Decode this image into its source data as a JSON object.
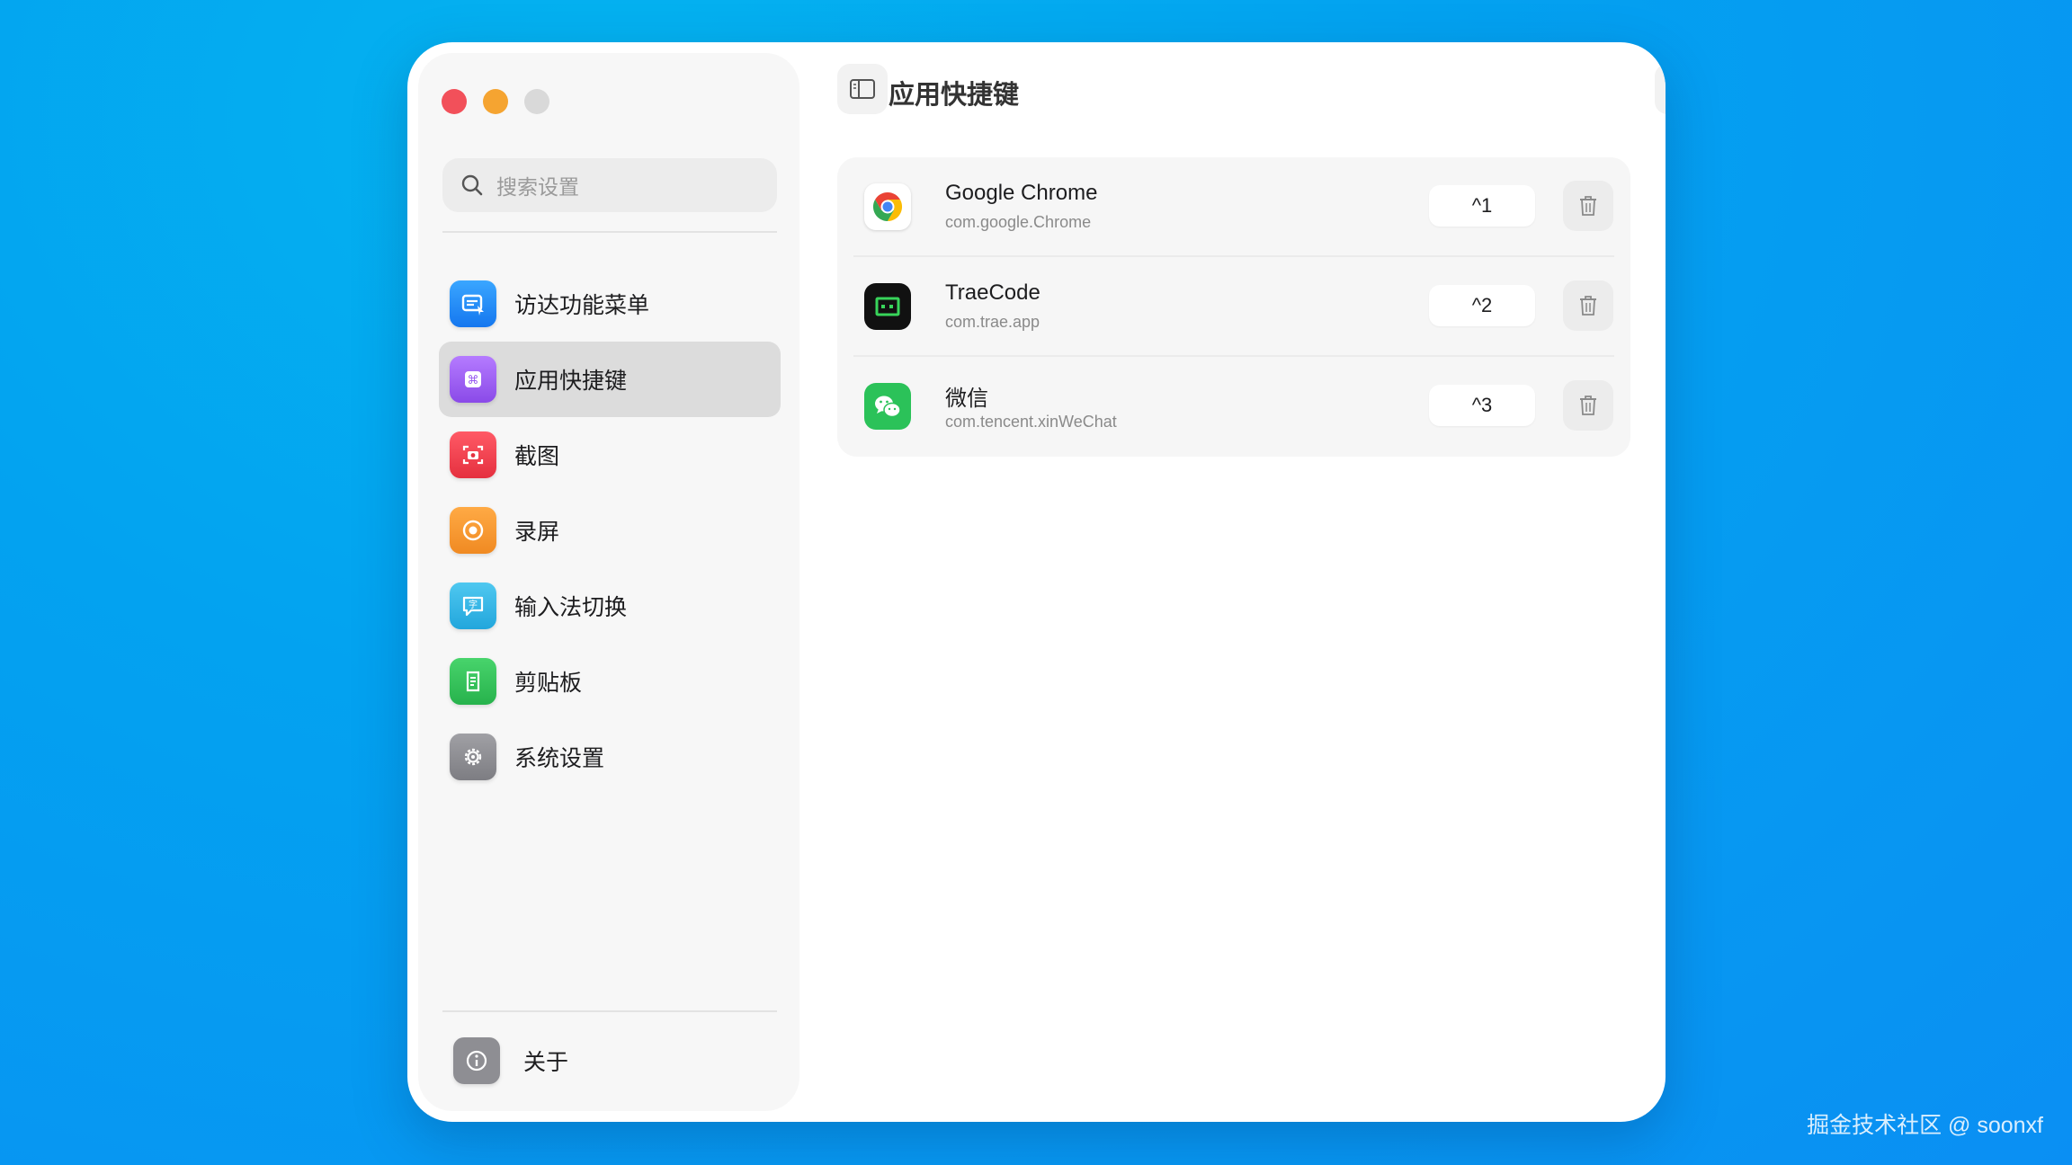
{
  "sidebar": {
    "search_placeholder": "搜索设置",
    "items": [
      {
        "label": "访达功能菜单",
        "icon": "finder-menu-icon",
        "color": "#1e8ef5"
      },
      {
        "label": "应用快捷键",
        "icon": "command-icon",
        "color": "#a25ef0"
      },
      {
        "label": "截图",
        "icon": "camera-icon",
        "color": "#f0414f"
      },
      {
        "label": "录屏",
        "icon": "record-icon",
        "color": "#f5982f"
      },
      {
        "label": "输入法切换",
        "icon": "input-method-icon",
        "color": "#35b6e6"
      },
      {
        "label": "剪贴板",
        "icon": "clipboard-icon",
        "color": "#35c459"
      },
      {
        "label": "系统设置",
        "icon": "gear-icon",
        "color": "#8e8e93"
      }
    ],
    "active_index": 1,
    "about_label": "关于"
  },
  "header": {
    "title": "应用快捷键",
    "toolbar_icons": [
      "sidebar-toggle-icon",
      "align-left-icon",
      "camera-icon",
      "drop-icon",
      "sort-arrows-icon",
      "plus-icon",
      "help-icon"
    ]
  },
  "apps": [
    {
      "name": "Google Chrome",
      "bundle": "com.google.Chrome",
      "shortcut": "^1"
    },
    {
      "name": "TraeCode",
      "bundle": "com.trae.app",
      "shortcut": "^2"
    },
    {
      "name": "微信",
      "bundle": "com.tencent.xinWeChat",
      "shortcut": "^3"
    }
  ],
  "watermark": "掘金技术社区 @ soonxf"
}
